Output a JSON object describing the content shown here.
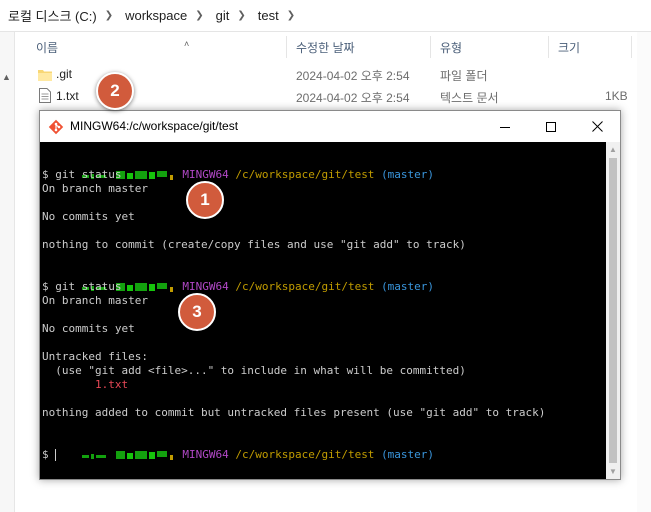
{
  "breadcrumb": [
    "로컬 디스크 (C:)",
    "workspace",
    "git",
    "test"
  ],
  "columns": {
    "name": "이름",
    "modified": "수정한 날짜",
    "type": "유형",
    "size": "크기"
  },
  "files": [
    {
      "name": ".git",
      "modified": "2024-04-02 오후 2:54",
      "type": "파일 폴더",
      "size": "",
      "icon": "folder-icon"
    },
    {
      "name": "1.txt",
      "modified": "2024-04-02 오후 2:54",
      "type": "텍스트 문서",
      "size": "1KB",
      "icon": "text-file-icon"
    }
  ],
  "terminal": {
    "title": "MINGW64:/c/workspace/git/test",
    "prompt_host": "MINGW64",
    "prompt_path": "/c/workspace/git/test",
    "prompt_branch": "(master)",
    "lines": {
      "cmd1": "$ git status",
      "b1": "On branch master",
      "nc1": "No commits yet",
      "nothing1": "nothing to commit (create/copy files and use \"git add\" to track)",
      "cmd2": "$ git status",
      "b2": "On branch master",
      "nc2": "No commits yet",
      "untracked": "Untracked files:",
      "hint": "  (use \"git add <file>...\" to include in what will be committed)",
      "file": "        1.txt",
      "nothing2": "nothing added to commit but untracked files present (use \"git add\" to track)",
      "prompt_end": "$ "
    }
  },
  "callouts": [
    "1",
    "2",
    "3"
  ],
  "colors": {
    "badge": "#d15b3c",
    "prompt_green": "#13a10e",
    "prompt_magenta": "#b148c6",
    "prompt_cyan": "#3a96dd",
    "untracked_red": "#e74856"
  }
}
